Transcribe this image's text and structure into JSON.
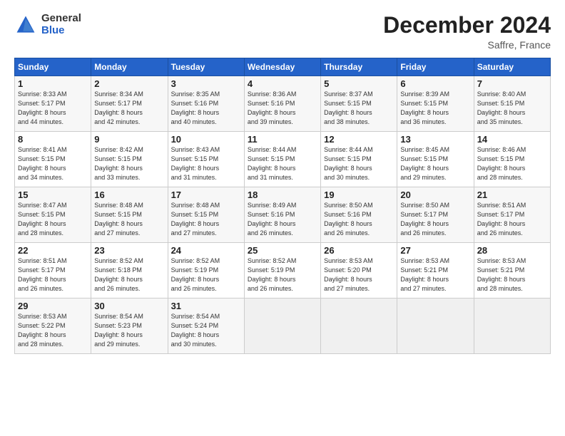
{
  "header": {
    "logo_general": "General",
    "logo_blue": "Blue",
    "month_title": "December 2024",
    "location": "Saffre, France"
  },
  "days_of_week": [
    "Sunday",
    "Monday",
    "Tuesday",
    "Wednesday",
    "Thursday",
    "Friday",
    "Saturday"
  ],
  "weeks": [
    [
      {
        "day": "1",
        "lines": [
          "Sunrise: 8:33 AM",
          "Sunset: 5:17 PM",
          "Daylight: 8 hours",
          "and 44 minutes."
        ]
      },
      {
        "day": "2",
        "lines": [
          "Sunrise: 8:34 AM",
          "Sunset: 5:17 PM",
          "Daylight: 8 hours",
          "and 42 minutes."
        ]
      },
      {
        "day": "3",
        "lines": [
          "Sunrise: 8:35 AM",
          "Sunset: 5:16 PM",
          "Daylight: 8 hours",
          "and 40 minutes."
        ]
      },
      {
        "day": "4",
        "lines": [
          "Sunrise: 8:36 AM",
          "Sunset: 5:16 PM",
          "Daylight: 8 hours",
          "and 39 minutes."
        ]
      },
      {
        "day": "5",
        "lines": [
          "Sunrise: 8:37 AM",
          "Sunset: 5:15 PM",
          "Daylight: 8 hours",
          "and 38 minutes."
        ]
      },
      {
        "day": "6",
        "lines": [
          "Sunrise: 8:39 AM",
          "Sunset: 5:15 PM",
          "Daylight: 8 hours",
          "and 36 minutes."
        ]
      },
      {
        "day": "7",
        "lines": [
          "Sunrise: 8:40 AM",
          "Sunset: 5:15 PM",
          "Daylight: 8 hours",
          "and 35 minutes."
        ]
      }
    ],
    [
      {
        "day": "8",
        "lines": [
          "Sunrise: 8:41 AM",
          "Sunset: 5:15 PM",
          "Daylight: 8 hours",
          "and 34 minutes."
        ]
      },
      {
        "day": "9",
        "lines": [
          "Sunrise: 8:42 AM",
          "Sunset: 5:15 PM",
          "Daylight: 8 hours",
          "and 33 minutes."
        ]
      },
      {
        "day": "10",
        "lines": [
          "Sunrise: 8:43 AM",
          "Sunset: 5:15 PM",
          "Daylight: 8 hours",
          "and 31 minutes."
        ]
      },
      {
        "day": "11",
        "lines": [
          "Sunrise: 8:44 AM",
          "Sunset: 5:15 PM",
          "Daylight: 8 hours",
          "and 31 minutes."
        ]
      },
      {
        "day": "12",
        "lines": [
          "Sunrise: 8:44 AM",
          "Sunset: 5:15 PM",
          "Daylight: 8 hours",
          "and 30 minutes."
        ]
      },
      {
        "day": "13",
        "lines": [
          "Sunrise: 8:45 AM",
          "Sunset: 5:15 PM",
          "Daylight: 8 hours",
          "and 29 minutes."
        ]
      },
      {
        "day": "14",
        "lines": [
          "Sunrise: 8:46 AM",
          "Sunset: 5:15 PM",
          "Daylight: 8 hours",
          "and 28 minutes."
        ]
      }
    ],
    [
      {
        "day": "15",
        "lines": [
          "Sunrise: 8:47 AM",
          "Sunset: 5:15 PM",
          "Daylight: 8 hours",
          "and 28 minutes."
        ]
      },
      {
        "day": "16",
        "lines": [
          "Sunrise: 8:48 AM",
          "Sunset: 5:15 PM",
          "Daylight: 8 hours",
          "and 27 minutes."
        ]
      },
      {
        "day": "17",
        "lines": [
          "Sunrise: 8:48 AM",
          "Sunset: 5:15 PM",
          "Daylight: 8 hours",
          "and 27 minutes."
        ]
      },
      {
        "day": "18",
        "lines": [
          "Sunrise: 8:49 AM",
          "Sunset: 5:16 PM",
          "Daylight: 8 hours",
          "and 26 minutes."
        ]
      },
      {
        "day": "19",
        "lines": [
          "Sunrise: 8:50 AM",
          "Sunset: 5:16 PM",
          "Daylight: 8 hours",
          "and 26 minutes."
        ]
      },
      {
        "day": "20",
        "lines": [
          "Sunrise: 8:50 AM",
          "Sunset: 5:17 PM",
          "Daylight: 8 hours",
          "and 26 minutes."
        ]
      },
      {
        "day": "21",
        "lines": [
          "Sunrise: 8:51 AM",
          "Sunset: 5:17 PM",
          "Daylight: 8 hours",
          "and 26 minutes."
        ]
      }
    ],
    [
      {
        "day": "22",
        "lines": [
          "Sunrise: 8:51 AM",
          "Sunset: 5:17 PM",
          "Daylight: 8 hours",
          "and 26 minutes."
        ]
      },
      {
        "day": "23",
        "lines": [
          "Sunrise: 8:52 AM",
          "Sunset: 5:18 PM",
          "Daylight: 8 hours",
          "and 26 minutes."
        ]
      },
      {
        "day": "24",
        "lines": [
          "Sunrise: 8:52 AM",
          "Sunset: 5:19 PM",
          "Daylight: 8 hours",
          "and 26 minutes."
        ]
      },
      {
        "day": "25",
        "lines": [
          "Sunrise: 8:52 AM",
          "Sunset: 5:19 PM",
          "Daylight: 8 hours",
          "and 26 minutes."
        ]
      },
      {
        "day": "26",
        "lines": [
          "Sunrise: 8:53 AM",
          "Sunset: 5:20 PM",
          "Daylight: 8 hours",
          "and 27 minutes."
        ]
      },
      {
        "day": "27",
        "lines": [
          "Sunrise: 8:53 AM",
          "Sunset: 5:21 PM",
          "Daylight: 8 hours",
          "and 27 minutes."
        ]
      },
      {
        "day": "28",
        "lines": [
          "Sunrise: 8:53 AM",
          "Sunset: 5:21 PM",
          "Daylight: 8 hours",
          "and 28 minutes."
        ]
      }
    ],
    [
      {
        "day": "29",
        "lines": [
          "Sunrise: 8:53 AM",
          "Sunset: 5:22 PM",
          "Daylight: 8 hours",
          "and 28 minutes."
        ]
      },
      {
        "day": "30",
        "lines": [
          "Sunrise: 8:54 AM",
          "Sunset: 5:23 PM",
          "Daylight: 8 hours",
          "and 29 minutes."
        ]
      },
      {
        "day": "31",
        "lines": [
          "Sunrise: 8:54 AM",
          "Sunset: 5:24 PM",
          "Daylight: 8 hours",
          "and 30 minutes."
        ]
      },
      null,
      null,
      null,
      null
    ]
  ]
}
